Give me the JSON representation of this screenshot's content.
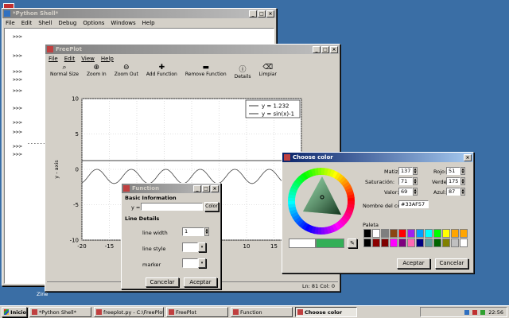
{
  "desktop": {
    "icon_label": "Pa",
    "icon2_label": "Zine"
  },
  "shell": {
    "title": "*Python Shell*",
    "menu": [
      "File",
      "Edit",
      "Shell",
      "Debug",
      "Options",
      "Windows",
      "Help"
    ],
    "prompts": [
      ">>>",
      ">>>",
      ">>>",
      ">>>",
      ">>>",
      ">>>",
      ">>>",
      ">>>",
      ">>>",
      ">>>",
      ">>>",
      ">>>"
    ],
    "extra": "--------"
  },
  "freeplot": {
    "title": "FreePlot",
    "menu": [
      "File",
      "Edit",
      "View",
      "Help"
    ],
    "toolbar": [
      "Normal Size",
      "Zoom In",
      "Zoom Out",
      "Add Function",
      "Remove Function",
      "Details",
      "Limpiar"
    ],
    "status": "Ln: 81 Col: 0",
    "chart_data": {
      "type": "line",
      "xlim": [
        -20,
        20
      ],
      "ylim": [
        -10,
        10
      ],
      "xticks": [
        "-20",
        "-15",
        "-10",
        "-5",
        "0",
        "5",
        "10",
        "15",
        "20"
      ],
      "yticks": [
        "10",
        "5",
        "0",
        "-5",
        "-10"
      ],
      "ylabel": "y - axis",
      "series": [
        {
          "name": "y = 1.232",
          "values": [
            1.232,
            1.232
          ]
        },
        {
          "name": "y = sin(x)-1"
        }
      ],
      "legend_position": "top-right",
      "grid": true
    }
  },
  "function_dialog": {
    "title": "Function",
    "basic_header": "Basic Information",
    "y_label": "y =",
    "y_value": "",
    "color_btn": "Color",
    "line_header": "Line Details",
    "line_width_label": "line width",
    "line_width_value": "1",
    "line_style_label": "line style",
    "marker_label": "marker",
    "cancel": "Cancelar",
    "accept": "Aceptar"
  },
  "color_dialog": {
    "title": "Choose color",
    "fields": {
      "hue_label": "Matiz:",
      "hue": "137",
      "sat_label": "Saturación:",
      "sat": "71",
      "val_label": "Valor:",
      "val": "69",
      "red_label": "Rojo:",
      "red": "51",
      "green_label": "Verde:",
      "green": "175",
      "blue_label": "Azul:",
      "blue": "87"
    },
    "name_label": "Nombre del color:",
    "name_value": "#33AF57",
    "palette_label": "Paleta",
    "palette": [
      "#000000",
      "#ffffff",
      "#7f7f7f",
      "#8b4513",
      "#ff0000",
      "#a020f0",
      "#00a0ff",
      "#00ffff",
      "#00ff00",
      "#ffff00",
      "#ffa500",
      "#ffa500",
      "#000000",
      "#8b0000",
      "#7f0000",
      "#ff00ff",
      "#7f007f",
      "#ff69b4",
      "#000080",
      "#5f9ea0",
      "#006400",
      "#808000",
      "#c0c0c0",
      "#ffffff"
    ],
    "current_color": "#33af57",
    "prev_color": "#ffffff",
    "accept": "Aceptar",
    "cancel": "Cancelar"
  },
  "taskbar": {
    "start": "Inicio",
    "items": [
      "*Python Shell*",
      "freeplot.py - C:\\FreePlot\\...",
      "FreePlot",
      "Function",
      "Choose color"
    ],
    "clock": "22:56"
  }
}
